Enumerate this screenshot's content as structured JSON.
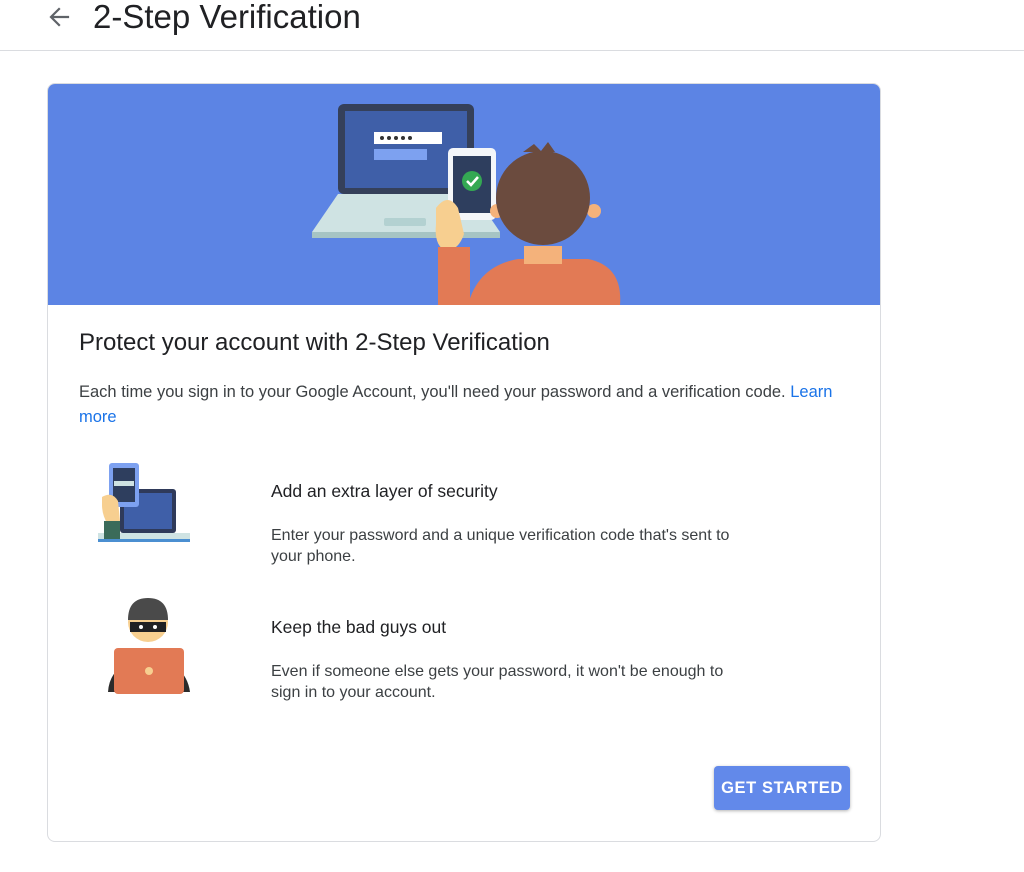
{
  "header": {
    "back_icon": "arrow-back-icon",
    "title": "2-Step Verification"
  },
  "card": {
    "banner_color": "#5c84e4",
    "title": "Protect your account with 2-Step Verification",
    "description": "Each time you sign in to your Google Account, you'll need your password and a verification code.",
    "learn_more": "Learn more",
    "features": [
      {
        "icon": "phone-laptop-illustration",
        "title": "Add an extra layer of security",
        "description": "Enter your password and a unique verification code that's sent to your phone."
      },
      {
        "icon": "hacker-illustration",
        "title": "Keep the bad guys out",
        "description": "Even if someone else gets your password, it won't be enough to sign in to your account."
      }
    ],
    "button_label": "GET STARTED",
    "button_color": "#6289ea",
    "link_color": "#1a73e8"
  }
}
